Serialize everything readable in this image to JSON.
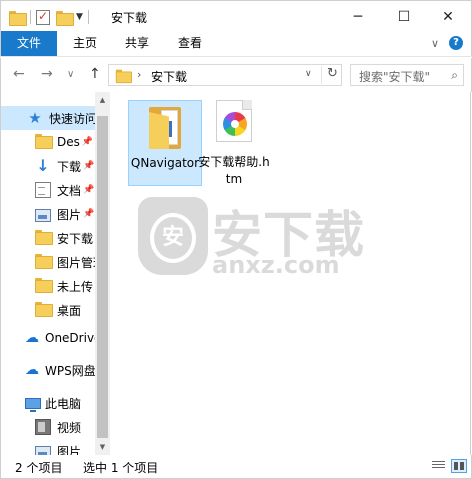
{
  "window": {
    "title": "安下载",
    "minimize_glyph": "─",
    "maximize_glyph": "☐",
    "close_glyph": "✕"
  },
  "ribbon": {
    "tabs": [
      {
        "label": "文件",
        "active": true
      },
      {
        "label": "主页"
      },
      {
        "label": "共享"
      },
      {
        "label": "查看"
      }
    ],
    "expand_glyph": "∨",
    "help_glyph": "?"
  },
  "navigation": {
    "back_glyph": "←",
    "forward_glyph": "→",
    "recent_glyph": "∨",
    "up_glyph": "↑"
  },
  "address": {
    "separator": "›",
    "path": "安下载",
    "dropdown_glyph": "∨",
    "refresh_glyph": "↻"
  },
  "search": {
    "placeholder": "搜索\"安下载\"",
    "icon_glyph": "⌕"
  },
  "nav_pane": {
    "items": [
      {
        "label": "快速访问",
        "icon": "star-icon",
        "selected": true
      },
      {
        "label": "Des",
        "icon": "folder-icon",
        "pinned": true
      },
      {
        "label": "下载",
        "icon": "download-icon",
        "pinned": true
      },
      {
        "label": "文档",
        "icon": "document-icon",
        "pinned": true
      },
      {
        "label": "图片",
        "icon": "pictures-icon",
        "pinned": true
      },
      {
        "label": "安下载",
        "icon": "folder-icon"
      },
      {
        "label": "图片管理",
        "icon": "folder-icon"
      },
      {
        "label": "未上传",
        "icon": "folder-icon"
      },
      {
        "label": "桌面",
        "icon": "folder-icon"
      },
      {
        "label": "OneDrive",
        "icon": "onedrive-icon"
      },
      {
        "label": "WPS网盘",
        "icon": "wps-cloud-icon"
      },
      {
        "label": "此电脑",
        "icon": "this-pc-icon"
      },
      {
        "label": "视频",
        "icon": "video-icon"
      },
      {
        "label": "图片",
        "icon": "pictures-icon"
      }
    ],
    "pin_glyph": "📌"
  },
  "scrollbar": {
    "up_glyph": "▲",
    "down_glyph": "▼"
  },
  "files": [
    {
      "name": "QNavigator",
      "type": "folder",
      "selected": true
    },
    {
      "name": "安下载帮助.htm",
      "type": "htm-file",
      "selected": false
    }
  ],
  "watermark": {
    "shield_text": "安",
    "main_text": "安下载",
    "sub_text": "anxz.com"
  },
  "status": {
    "item_count": "2 个项目",
    "selected_count": "选中 1 个项目"
  },
  "colors": {
    "accent": "#1979ca",
    "selection": "#cce8ff"
  }
}
